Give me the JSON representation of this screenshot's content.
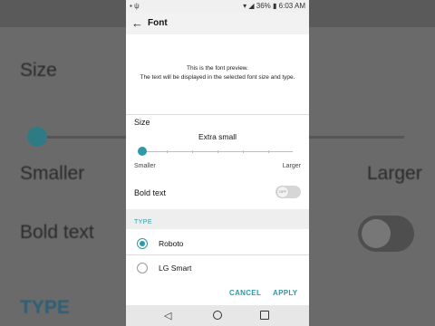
{
  "background": {
    "size_label": "Size",
    "smaller_label": "Smaller",
    "larger_label": "Larger",
    "bold_label": "Bold text",
    "toggle_text": "OFF",
    "type_label": "TYPE"
  },
  "status_bar": {
    "battery": "36%",
    "time": "6:03 AM"
  },
  "app_bar": {
    "title": "Font"
  },
  "preview": {
    "line1": "This is the font preview.",
    "line2": "The text will be displayed in the selected font size and type."
  },
  "size": {
    "label": "Size",
    "value": "Extra small",
    "min_label": "Smaller",
    "max_label": "Larger",
    "selected_step": 0,
    "steps": 7
  },
  "bold_text": {
    "label": "Bold text",
    "state": "OFF"
  },
  "type": {
    "header": "TYPE",
    "options": [
      {
        "label": "Roboto",
        "selected": true
      },
      {
        "label": "LG Smart",
        "selected": false
      }
    ]
  },
  "actions": {
    "cancel": "CANCEL",
    "apply": "APPLY"
  },
  "colors": {
    "accent": "#2e9aa8"
  }
}
